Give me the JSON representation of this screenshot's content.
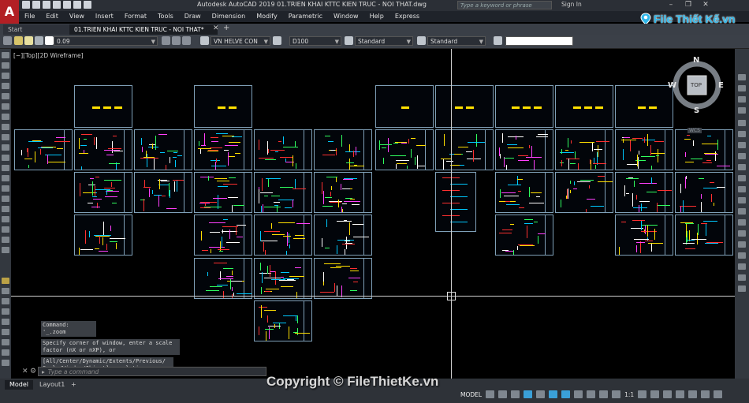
{
  "window": {
    "logo": "A",
    "title": "Autodesk AutoCAD 2019    01.TRIEN KHAI KTTC KIEN TRUC - NOI THAT.dwg",
    "search_placeholder": "Type a keyword or phrase",
    "signin": "Sign In",
    "controls": [
      "–",
      "❐",
      "✕"
    ]
  },
  "brand": {
    "text": "File Thiết Kế.vn"
  },
  "menu": [
    "File",
    "Edit",
    "View",
    "Insert",
    "Format",
    "Tools",
    "Draw",
    "Dimension",
    "Modify",
    "Parametric",
    "Window",
    "Help",
    "Express"
  ],
  "tabs": {
    "start": "Start",
    "active": "01.TRIEN KHAI KTTC KIEN TRUC - NOI THAT*",
    "add": "+"
  },
  "properties": {
    "layer": "0.09",
    "text_style": "VN HELVE CON",
    "dim_style": "D100",
    "table_style": "Standard",
    "multileader_style": "Standard"
  },
  "viewport": {
    "label": "[−][Top][2D Wireframe]"
  },
  "viewcube": {
    "n": "N",
    "s": "S",
    "e": "E",
    "w": "W",
    "face": "TOP",
    "wcs": "WCS"
  },
  "command": {
    "history": [
      "Command: '_.zoom",
      "Specify corner of window, enter a scale factor (nX or nXP), or",
      "[All/Center/Dynamic/Extents/Previous/ Scale/Window/Object] <real time>: _e"
    ],
    "placeholder": "Type a command"
  },
  "layout_tabs": [
    "Model",
    "Layout1",
    "+"
  ],
  "status": {
    "model": "MODEL",
    "scale": "1:1"
  },
  "watermark": "Copyright © FileThietKe.vn",
  "colors": {
    "accent": "#2fb7ea",
    "sheet_border": "#7fa0b8",
    "autocad_red": "#b21f24",
    "dash": "#ffe000"
  }
}
